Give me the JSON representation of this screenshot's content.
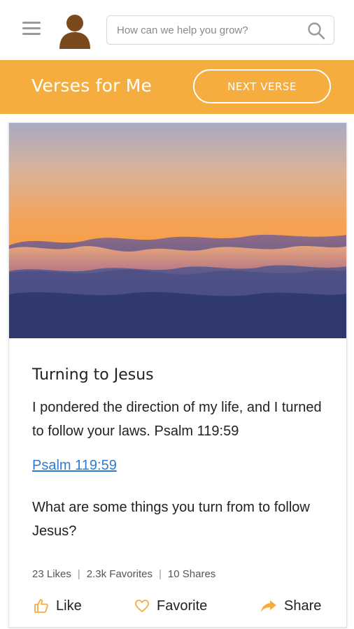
{
  "header": {
    "search_placeholder": "How can we help you grow?",
    "menu_icon": "hamburger-icon",
    "avatar_icon": "user-avatar-icon",
    "search_icon": "search-icon"
  },
  "banner": {
    "title": "Verses for Me",
    "next_button": "NEXT VERSE",
    "color": "#f5ad3f"
  },
  "card": {
    "image": "sunrise-over-clouds",
    "title": "Turning to Jesus",
    "verse": "I pondered the direction of my life, and I turned to follow your laws. Psalm 119:59",
    "reference": "Psalm 119:59",
    "question": "What are some things you turn from to follow Jesus?",
    "stats": {
      "likes": "23 Likes",
      "favorites": "2.3k Favorites",
      "shares": "10 Shares",
      "separator": "|"
    },
    "actions": {
      "like": "Like",
      "favorite": "Favorite",
      "share": "Share"
    },
    "accent_color": "#f5ad3f",
    "link_color": "#2d7bd6"
  }
}
